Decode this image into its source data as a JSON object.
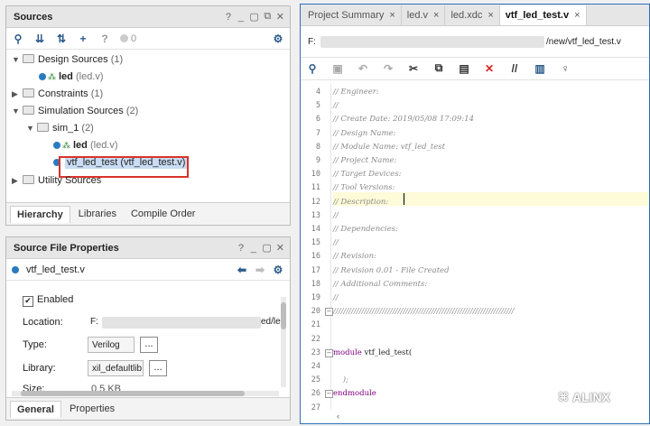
{
  "sources": {
    "title": "Sources",
    "count_label": "0",
    "tree": [
      {
        "label": "Design Sources",
        "count": "(1)"
      },
      {
        "name": "led",
        "file": "(led.v)"
      },
      {
        "label": "Constraints",
        "count": "(1)"
      },
      {
        "label": "Simulation Sources",
        "count": "(2)"
      },
      {
        "label": "sim_1",
        "count": "(2)"
      },
      {
        "name": "led",
        "file": "(led.v)"
      },
      {
        "selected": "vtf_led_test (vtf_led_test.v)"
      },
      {
        "label": "Utility Sources"
      }
    ],
    "tabs": [
      "Hierarchy",
      "Libraries",
      "Compile Order"
    ]
  },
  "props": {
    "title": "Source File Properties",
    "file": "vtf_led_test.v",
    "enabled": "Enabled",
    "location_label": "Location:",
    "location_prefix": "F:",
    "location_suffix": "ed/led",
    "type_label": "Type:",
    "type_value": "Verilog",
    "library_label": "Library:",
    "library_value": "xil_defaultlib",
    "size_label": "Size:",
    "size_value": "0.5 KB",
    "ellipsis": "...",
    "tabs": [
      "General",
      "Properties"
    ]
  },
  "editor": {
    "tabs": [
      {
        "label": "Project Summary",
        "close": "×"
      },
      {
        "label": "led.v",
        "close": "×"
      },
      {
        "label": "led.xdc",
        "close": "×"
      },
      {
        "label": "vtf_led_test.v",
        "close": "×"
      }
    ],
    "path_prefix": "F:",
    "path_suffix": "/new/vtf_led_test.v",
    "lines": [
      {
        "n": "4",
        "t": "// Engineer:"
      },
      {
        "n": "5",
        "t": "//"
      },
      {
        "n": "6",
        "t": "// Create Date: 2019/05/08 17:09:14"
      },
      {
        "n": "7",
        "t": "// Design Name:"
      },
      {
        "n": "8",
        "t": "// Module Name: vtf_led_test"
      },
      {
        "n": "9",
        "t": "// Project Name:"
      },
      {
        "n": "10",
        "t": "// Target Devices:"
      },
      {
        "n": "11",
        "t": "// Tool Versions:"
      },
      {
        "n": "12",
        "t": "// Description:"
      },
      {
        "n": "13",
        "t": "//"
      },
      {
        "n": "14",
        "t": "// Dependencies:"
      },
      {
        "n": "15",
        "t": "//"
      },
      {
        "n": "16",
        "t": "// Revision:"
      },
      {
        "n": "17",
        "t": "// Revision 0.01 - File Created"
      },
      {
        "n": "18",
        "t": "// Additional Comments:"
      },
      {
        "n": "19",
        "t": "//"
      },
      {
        "n": "20",
        "t": "//////////////////////////////////////////////////////////////////////"
      },
      {
        "n": "21",
        "t": ""
      },
      {
        "n": "22",
        "t": ""
      },
      {
        "n": "23",
        "kw": "module",
        "t": " vtf_led_test("
      },
      {
        "n": "24",
        "t": ""
      },
      {
        "n": "25",
        "t": "    );"
      },
      {
        "n": "26",
        "kw": "endmodule",
        "t": ""
      },
      {
        "n": "27",
        "t": ""
      }
    ]
  },
  "watermark": "ALINX"
}
